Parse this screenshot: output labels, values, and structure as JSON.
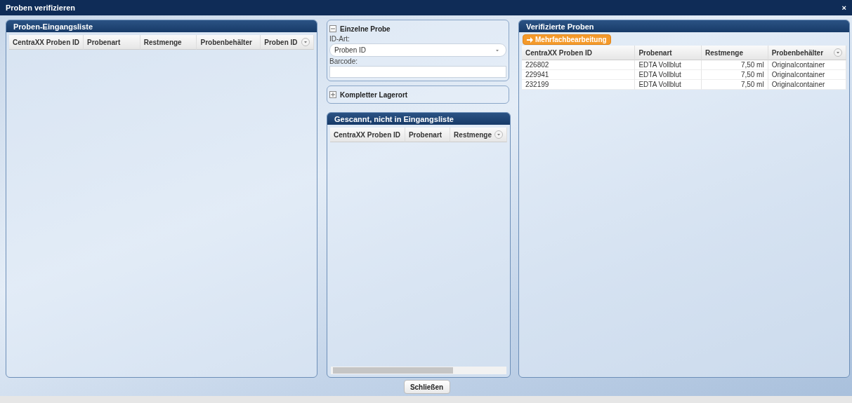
{
  "window": {
    "title": "Proben verifizieren",
    "close": "×"
  },
  "incoming": {
    "title": "Proben-Eingangsliste",
    "columns": [
      "CentraXX Proben ID",
      "Probenart",
      "Restmenge",
      "Probenbehälter",
      "Proben ID"
    ]
  },
  "sections": [
    {
      "title": "Einzelne Probe",
      "expanded": true,
      "fields": [
        {
          "kind": "select",
          "label": "ID-Art:",
          "value": "Proben ID"
        },
        {
          "kind": "text",
          "label": "Barcode:"
        }
      ]
    },
    {
      "title": "Kompletter Lagerort",
      "expanded": false
    }
  ],
  "scanned": {
    "title": "Gescannt, nicht in Eingangsliste",
    "columns": [
      "CentraXX Proben ID",
      "Probenart",
      "Restmenge"
    ]
  },
  "verified": {
    "title": "Verifizierte Proben",
    "action": "Mehrfachbearbeitung",
    "columns": [
      "CentraXX Proben ID",
      "Probenart",
      "Restmenge",
      "Probenbehälter"
    ],
    "rows": [
      [
        "226802",
        "EDTA Vollblut",
        "7,50 ml",
        "Originalcontainer"
      ],
      [
        "229941",
        "EDTA Vollblut",
        "7,50 ml",
        "Originalcontainer"
      ],
      [
        "232199",
        "EDTA Vollblut",
        "7,50 ml",
        "Originalcontainer"
      ]
    ]
  },
  "buttons": [
    "Schließen"
  ]
}
